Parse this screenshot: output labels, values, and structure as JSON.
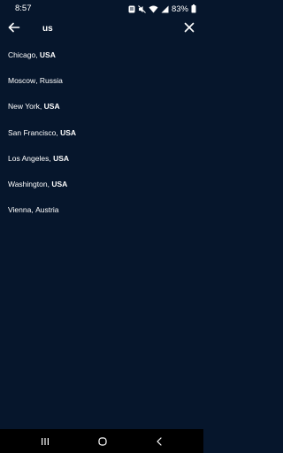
{
  "status_bar": {
    "time": "8:57",
    "battery": "83%"
  },
  "search": {
    "query": "us"
  },
  "results": [
    {
      "city": "Chicago",
      "country": "USA"
    },
    {
      "city": "Moscow",
      "country": "Russia"
    },
    {
      "city": "New York",
      "country": "USA"
    },
    {
      "city": "San Francisco",
      "country": "USA"
    },
    {
      "city": "Los Angeles",
      "country": "USA"
    },
    {
      "city": "Washington",
      "country": "USA"
    },
    {
      "city": "Vienna",
      "country": "Austria"
    }
  ],
  "icons": {
    "back": "arrow-left-icon",
    "clear": "close-icon",
    "nav_recents": "recents-icon",
    "nav_home": "home-icon",
    "nav_back": "chevron-left-icon"
  },
  "colors": {
    "background": "#06162c",
    "text": "#ffffff",
    "nav_bar": "#000000"
  }
}
